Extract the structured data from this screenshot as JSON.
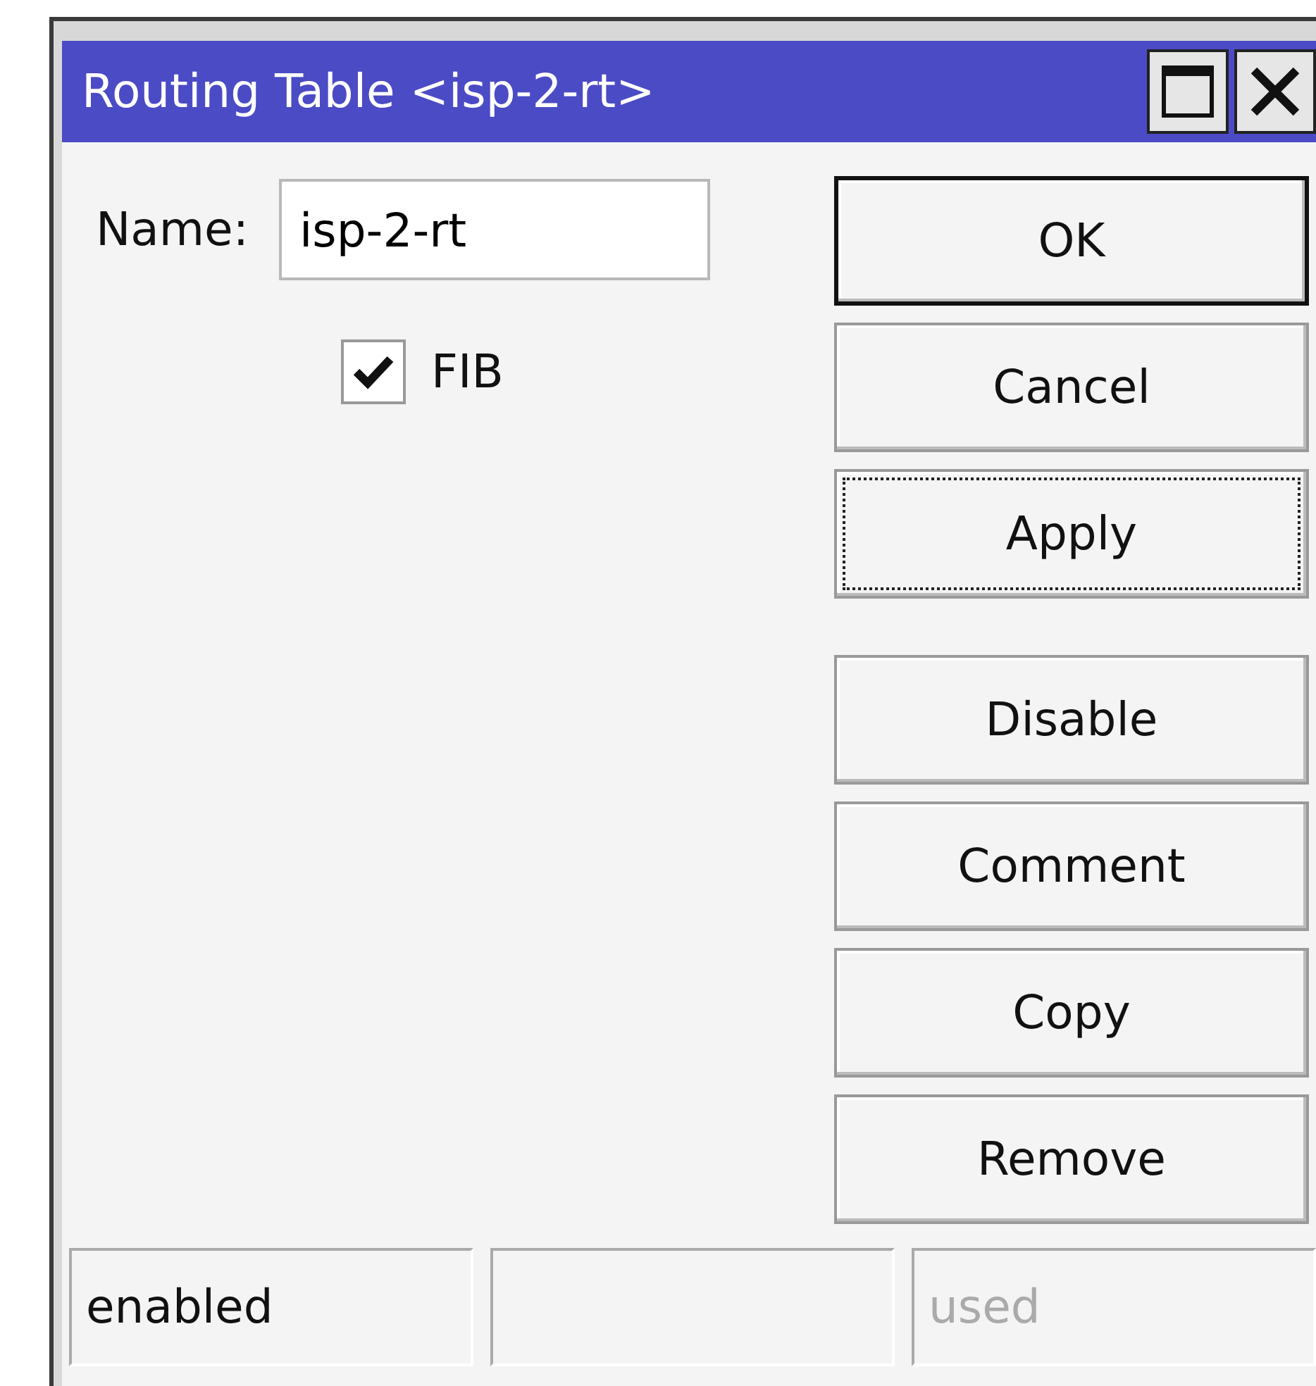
{
  "window": {
    "title": "Routing Table <isp-2-rt>"
  },
  "form": {
    "name_label": "Name:",
    "name_value": "isp-2-rt",
    "fib": {
      "label": "FIB",
      "checked": true
    }
  },
  "buttons": [
    {
      "label": "OK",
      "default": true,
      "focused": false
    },
    {
      "label": "Cancel",
      "default": false,
      "focused": false
    },
    {
      "label": "Apply",
      "default": false,
      "focused": true
    }
  ],
  "actions": [
    {
      "label": "Disable"
    },
    {
      "label": "Comment"
    },
    {
      "label": "Copy"
    },
    {
      "label": "Remove"
    }
  ],
  "status_bar": {
    "cell_1": {
      "text": "enabled",
      "disabled": false
    },
    "cell_3": {
      "text": "used",
      "disabled": true
    }
  }
}
